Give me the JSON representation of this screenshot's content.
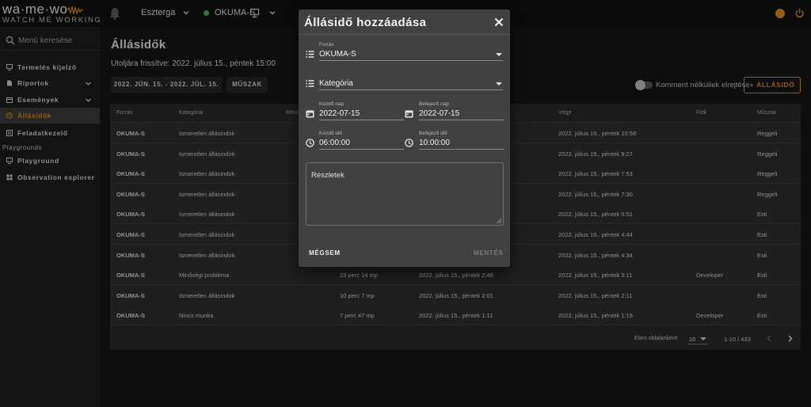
{
  "header": {
    "logo_main_a": "wa·me·wo",
    "logo_sub": "WATCH ME WORKING",
    "plant": "Esztergа",
    "machine": "OKUMA-S",
    "status_color": "#4caf50",
    "accent_color": "#d98b1c"
  },
  "sidebar": {
    "search_placeholder": "Menü keresése",
    "items": [
      {
        "label": "Termelés kijelző",
        "icon": "monitor-icon"
      },
      {
        "label": "Riportok",
        "icon": "report-icon",
        "expandable": true
      },
      {
        "label": "Események",
        "icon": "calendar-icon",
        "expandable": true
      },
      {
        "label": "Állásidők",
        "icon": "clock-icon",
        "active": true
      },
      {
        "label": "Feladatkezelő",
        "icon": "tasks-icon"
      }
    ],
    "section_label": "Playgrounds",
    "playground_items": [
      {
        "label": "Playground",
        "icon": "monitor-icon"
      },
      {
        "label": "Observation explorer",
        "icon": "grid-icon"
      }
    ]
  },
  "main": {
    "title": "Állásidők",
    "refresh_text": "Utoljára frissítve: 2022. július 15., péntek 15:00",
    "date_range": "2022. JÚN. 15. - 2022. JÚL. 15.",
    "shift_button": "MŰSZAK",
    "toggle_label": "Komment nélküliek elrejtése",
    "add_button": "+ ÁLLÁSIDŐ"
  },
  "table": {
    "columns": [
      "Forrás",
      "Kategória",
      "Részlet",
      "",
      "",
      "Vége",
      "Fiók",
      "Műszak"
    ],
    "rows": [
      {
        "source": "OKUMA-S",
        "category": "Ismeretlen állásindok",
        "duration": "",
        "start": "",
        "end": "2022. július 15., péntek 10:58",
        "account": "",
        "shift": "Reggeli"
      },
      {
        "source": "OKUMA-S",
        "category": "Ismeretlen állásindok",
        "duration": "",
        "start": "",
        "end": "2022. július 15., péntek 9:27",
        "account": "",
        "shift": "Reggeli"
      },
      {
        "source": "OKUMA-S",
        "category": "Ismeretlen állásindok",
        "duration": "",
        "start": "",
        "end": "2022. július 15., péntek 7:53",
        "account": "",
        "shift": "Reggeli"
      },
      {
        "source": "OKUMA-S",
        "category": "Ismeretlen állásindok",
        "duration": "",
        "start": "",
        "end": "2022. július 15., péntek 7:30",
        "account": "",
        "shift": "Reggeli"
      },
      {
        "source": "OKUMA-S",
        "category": "Ismeretlen állásindok",
        "duration": "",
        "start": "",
        "end": "2022. július 15., péntek 5:51",
        "account": "",
        "shift": "Esti"
      },
      {
        "source": "OKUMA-S",
        "category": "Ismeretlen állásindok",
        "duration": "",
        "start": "",
        "end": "2022. július 15., péntek 4:44",
        "account": "",
        "shift": "Esti"
      },
      {
        "source": "OKUMA-S",
        "category": "Ismeretlen állásindok",
        "duration": "",
        "start": "",
        "end": "2022. július 15., péntek 4:34",
        "account": "",
        "shift": "Esti"
      },
      {
        "source": "OKUMA-S",
        "category": "Minőségi probléma",
        "duration": "23 perc 14 mp",
        "start": "2022. július 15., péntek 2:48",
        "end": "2022. július 15., péntek 3:11",
        "account": "Developer",
        "shift": "Esti"
      },
      {
        "source": "OKUMA-S",
        "category": "Ismeretlen állásindok",
        "duration": "10 perc 7 mp",
        "start": "2022. július 15., péntek 2:01",
        "end": "2022. július 15., péntek 2:11",
        "account": "",
        "shift": "Esti"
      },
      {
        "source": "OKUMA-S",
        "category": "Nincs munka",
        "duration": "7 perc 47 mp",
        "start": "2022. július 15., péntek 1:11",
        "end": "2022. július 15., péntek 1:19",
        "account": "Developer",
        "shift": "Esti"
      }
    ],
    "pager_label": "Elem oldalanként:",
    "page_size": "10",
    "range": "1-10 / 433"
  },
  "modal": {
    "title": "Állásidő hozzáadása",
    "source_label": "Forrás",
    "source_value": "OKUMA-S",
    "category_label": "Kategória",
    "start_date_label": "Kezdő nap",
    "start_date": "2022-07-15",
    "end_date_label": "Befejező nap",
    "end_date": "2022-07-15",
    "start_time_label": "Kezdő idő",
    "start_time": "06:00:00",
    "end_time_label": "Befejező idő",
    "end_time": "10:00:00",
    "details_label": "Részletek",
    "cancel": "MÉGSEM",
    "save": "MENTÉS"
  }
}
